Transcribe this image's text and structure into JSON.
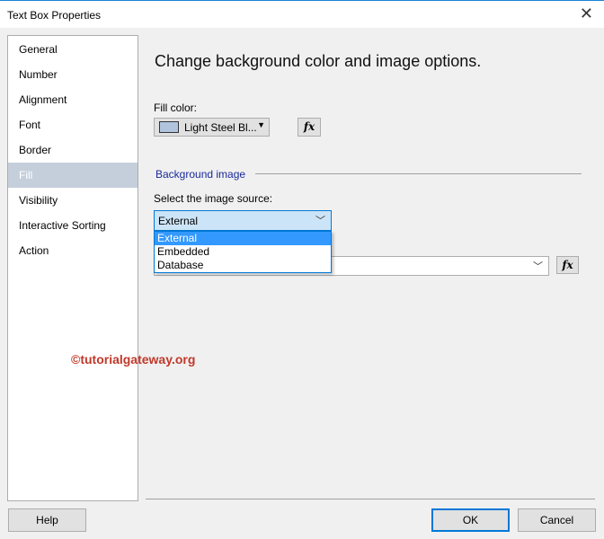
{
  "window": {
    "title": "Text Box Properties"
  },
  "sidebar": {
    "items": [
      {
        "label": "General"
      },
      {
        "label": "Number"
      },
      {
        "label": "Alignment"
      },
      {
        "label": "Font"
      },
      {
        "label": "Border"
      },
      {
        "label": "Fill",
        "selected": true
      },
      {
        "label": "Visibility"
      },
      {
        "label": "Interactive Sorting"
      },
      {
        "label": "Action"
      }
    ]
  },
  "main": {
    "heading": "Change background color and image options.",
    "fill_color_label": "Fill color:",
    "fill_color_value": "Light Steel Bl...",
    "fill_color_hex": "#b0c4de",
    "fx_label": "fx",
    "section_title": "Background image",
    "source_label": "Select the image source:",
    "source_value": "External",
    "source_options": [
      "External",
      "Embedded",
      "Database"
    ]
  },
  "watermark": "©tutorialgateway.org",
  "footer": {
    "help": "Help",
    "ok": "OK",
    "cancel": "Cancel"
  }
}
